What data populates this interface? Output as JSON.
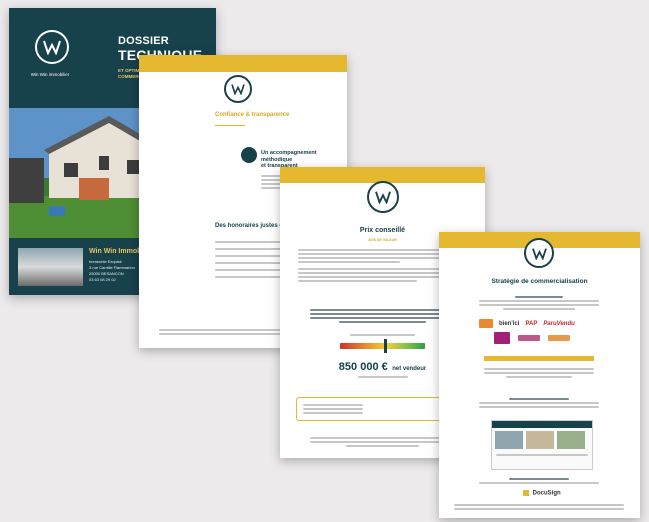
{
  "colors": {
    "teal": "#17414b",
    "gold": "#e4b92f",
    "background": "#eceaea"
  },
  "doc1": {
    "title_line1": "DOSSIER",
    "title_line2": "TECHNIQUE",
    "title_sub": "ET OPTIMISATION DE LA COMMERCIALISATION",
    "brand_name": "Win Win immobilier",
    "agency_name": "Win Win Immobilier",
    "address_lines": [
      "Immeuble Exquisé",
      "3 rue Camille Flammarion",
      "25000 BESANCON",
      "03 63 08 29 02"
    ]
  },
  "doc2": {
    "heading": "Confiance & transparence",
    "accomp_lines": [
      "Un accompagnement",
      "méthodique",
      "et transparent"
    ],
    "rates_heading": "Des honoraires justes et forfaitaires"
  },
  "doc3": {
    "heading": "Prix conseillé",
    "subheading": "AVIS DE VALEUR",
    "price": "850 000 €",
    "price_note": "net vendeur"
  },
  "doc4": {
    "heading": "Stratégie de commercialisation",
    "portals": [
      "bien'ici",
      "PAP",
      "ParuVendu"
    ],
    "esign": "DocuSign"
  }
}
